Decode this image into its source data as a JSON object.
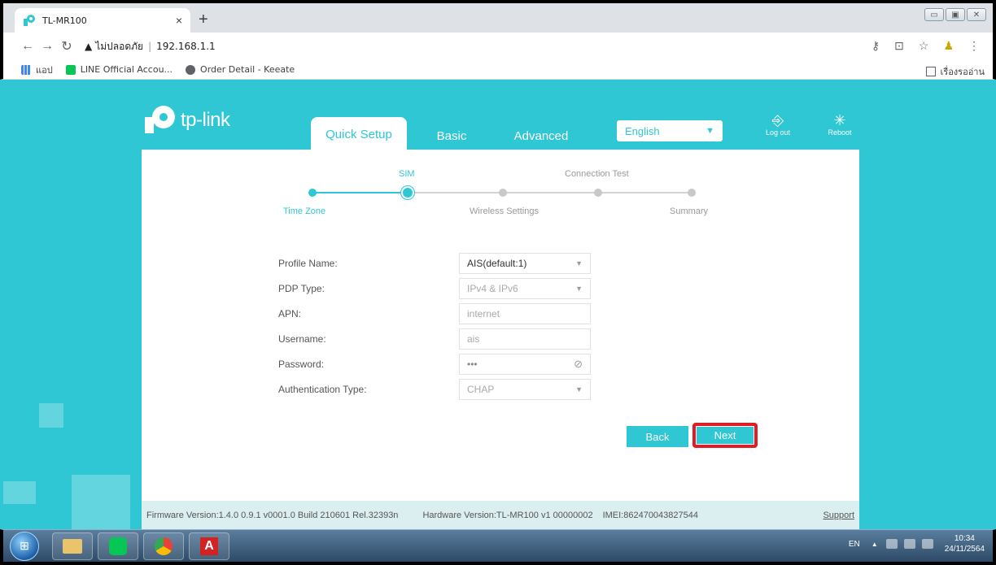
{
  "browser": {
    "tab_title": "TL-MR100",
    "tab_close": "×",
    "new_tab": "+",
    "security_text": "ไม่ปลอดภัย",
    "url": "192.168.1.1",
    "bookmarks": [
      {
        "label": "แอป",
        "icon": "apps-icon",
        "color": "#e8453c"
      },
      {
        "label": "LINE Official Accou...",
        "icon": "line-icon",
        "color": "#06c755"
      },
      {
        "label": "Order Detail - Keeate",
        "icon": "globe-icon",
        "color": "#5f6368"
      }
    ],
    "reading_list": "เรื่องรออ่าน"
  },
  "router": {
    "brand": "tp-link",
    "nav": {
      "quick_setup": "Quick Setup",
      "basic": "Basic",
      "advanced": "Advanced"
    },
    "language": "English",
    "logout": "Log out",
    "reboot": "Reboot",
    "steps": {
      "top": [
        "SIM",
        "Connection Test"
      ],
      "bottom": [
        "Time Zone",
        "Wireless Settings",
        "Summary"
      ],
      "current_index": 1,
      "total": 5
    },
    "form": {
      "profile_name_label": "Profile Name:",
      "profile_name_value": "AIS(default:1)",
      "pdp_type_label": "PDP Type:",
      "pdp_type_value": "IPv4 & IPv6",
      "apn_label": "APN:",
      "apn_value": "internet",
      "username_label": "Username:",
      "username_value": "ais",
      "password_label": "Password:",
      "password_value": "•••",
      "auth_type_label": "Authentication Type:",
      "auth_type_value": "CHAP"
    },
    "buttons": {
      "back": "Back",
      "next": "Next"
    },
    "footer": {
      "firmware": "Firmware Version:1.4.0 0.9.1 v0001.0 Build 210601 Rel.32393n",
      "hardware": "Hardware Version:TL-MR100 v1 00000002",
      "imei": "IMEI:862470043827544",
      "support": "Support"
    }
  },
  "taskbar": {
    "lang": "EN",
    "time": "10:34",
    "date": "24/11/2564"
  },
  "colors": {
    "accent": "#2ec7d3",
    "highlight": "#e11c24"
  }
}
